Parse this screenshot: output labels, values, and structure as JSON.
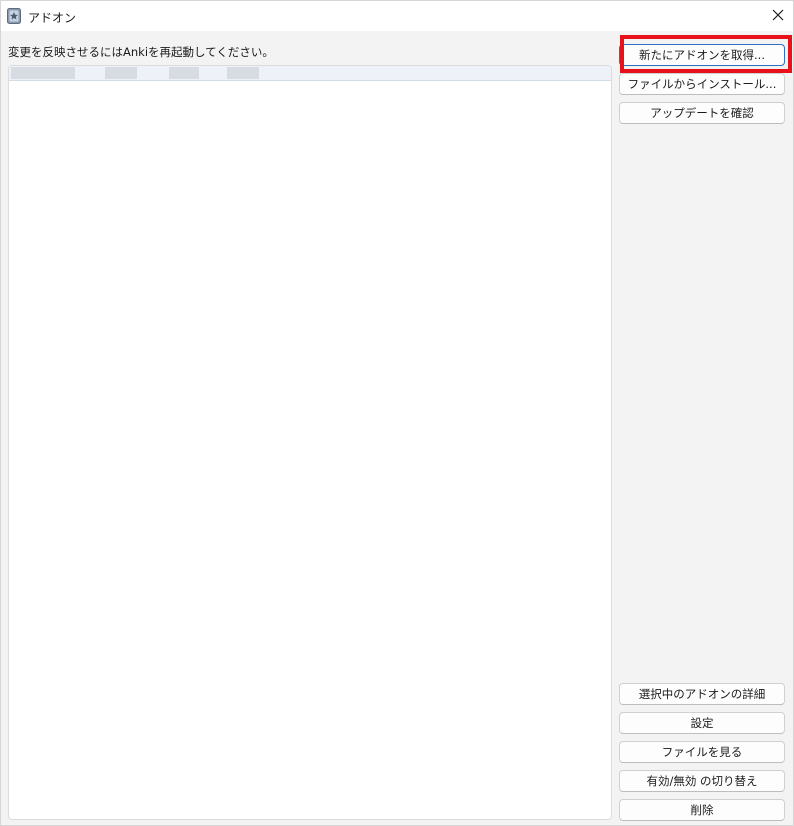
{
  "window": {
    "title": "アドオン",
    "icons": {
      "app": "anki-app-icon",
      "close": "close-icon"
    }
  },
  "notice": "変更を反映させるにはAnkiを再起動してください。",
  "addon_list": {
    "items": [
      {
        "label": "",
        "selected": true
      }
    ]
  },
  "buttons": {
    "get_addons": "新たにアドオンを取得...",
    "install_from_file": "ファイルからインストール...",
    "check_updates": "アップデートを確認",
    "view_details": "選択中のアドオンの詳細",
    "config": "設定",
    "view_files": "ファイルを見る",
    "toggle_enabled": "有効/無効 の切り替え",
    "delete": "削除"
  },
  "colors": {
    "highlight": "#e8111b",
    "focus_border": "#2f6fc3"
  }
}
